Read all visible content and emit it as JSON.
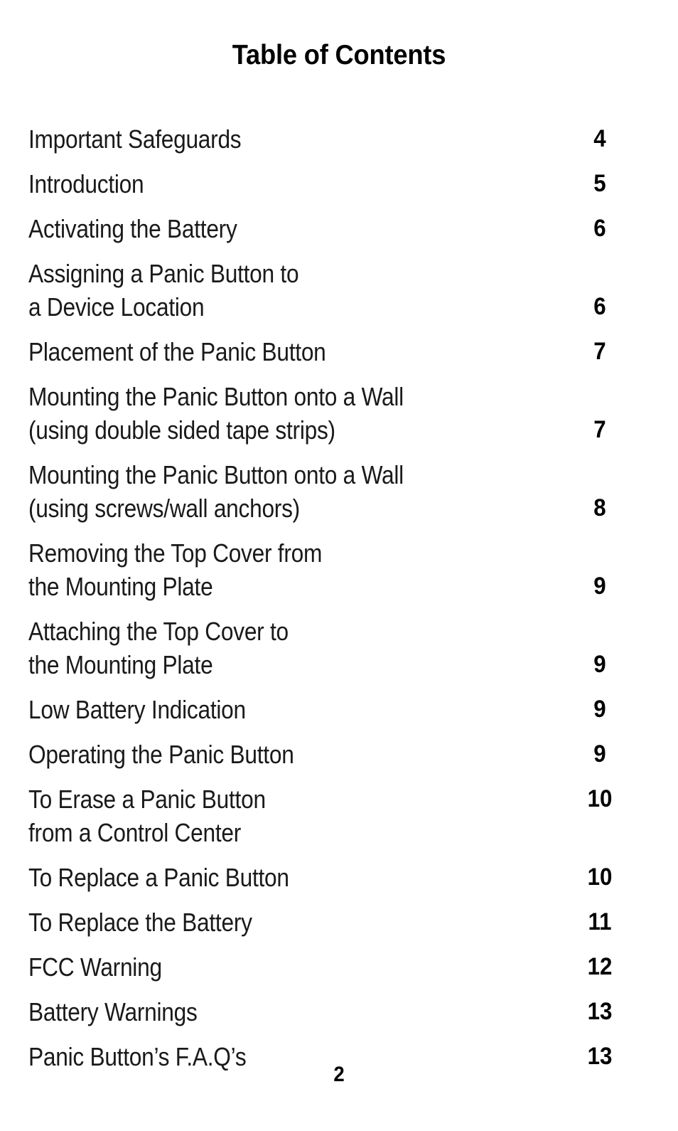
{
  "document": {
    "title": "Table of Contents",
    "folio": "2"
  },
  "toc": {
    "entries": [
      {
        "label": "Important Safeguards",
        "page": "4",
        "lines": 1,
        "page_align": "first"
      },
      {
        "label": "Introduction",
        "page": "5",
        "lines": 1,
        "page_align": "first"
      },
      {
        "label": "Activating the Battery",
        "page": "6",
        "lines": 1,
        "page_align": "first"
      },
      {
        "label": "Assigning a Panic Button to\na Device Location",
        "page": "6",
        "lines": 2,
        "page_align": "last"
      },
      {
        "label": "Placement of the Panic Button",
        "page": "7",
        "lines": 1,
        "page_align": "first"
      },
      {
        "label": "Mounting the Panic Button onto a Wall\n(using double sided tape strips)",
        "page": "7",
        "lines": 2,
        "page_align": "last"
      },
      {
        "label": "Mounting the Panic Button onto a Wall\n(using screws/wall anchors)",
        "page": "8",
        "lines": 2,
        "page_align": "last"
      },
      {
        "label": "Removing the Top Cover from\nthe Mounting Plate",
        "page": "9",
        "lines": 2,
        "page_align": "last"
      },
      {
        "label": "Attaching the Top Cover to\nthe Mounting Plate",
        "page": "9",
        "lines": 2,
        "page_align": "last"
      },
      {
        "label": "Low Battery Indication",
        "page": "9",
        "lines": 1,
        "page_align": "first"
      },
      {
        "label": "Operating the Panic Button",
        "page": "9",
        "lines": 1,
        "page_align": "first"
      },
      {
        "label": "To Erase a Panic Button\nfrom a Control Center",
        "page": "10",
        "lines": 2,
        "page_align": "first"
      },
      {
        "label": "To Replace a Panic Button",
        "page": "10",
        "lines": 1,
        "page_align": "first"
      },
      {
        "label": "To Replace the Battery",
        "page": "11",
        "lines": 1,
        "page_align": "first"
      },
      {
        "label": "FCC Warning",
        "page": "12",
        "lines": 1,
        "page_align": "first"
      },
      {
        "label": "Battery Warnings",
        "page": "13",
        "lines": 1,
        "page_align": "first"
      },
      {
        "label": "Panic Button’s F.A.Q’s",
        "page": "13",
        "lines": 1,
        "page_align": "first"
      }
    ]
  }
}
